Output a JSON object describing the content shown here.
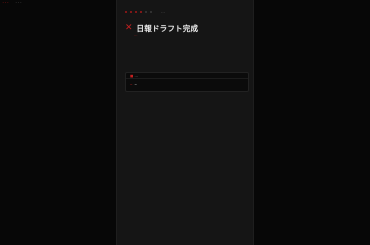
{
  "background": {
    "top_left_text": "…",
    "top_left_muted": "…"
  },
  "panel": {
    "breadcrumb": "…",
    "title": "日報ドラフト完成",
    "subtitle": "…",
    "code": {
      "header": "…",
      "prompt": "…",
      "command": "…"
    }
  },
  "colors": {
    "accent": "#c42020",
    "panel_bg": "#151515",
    "page_bg": "#000000"
  }
}
